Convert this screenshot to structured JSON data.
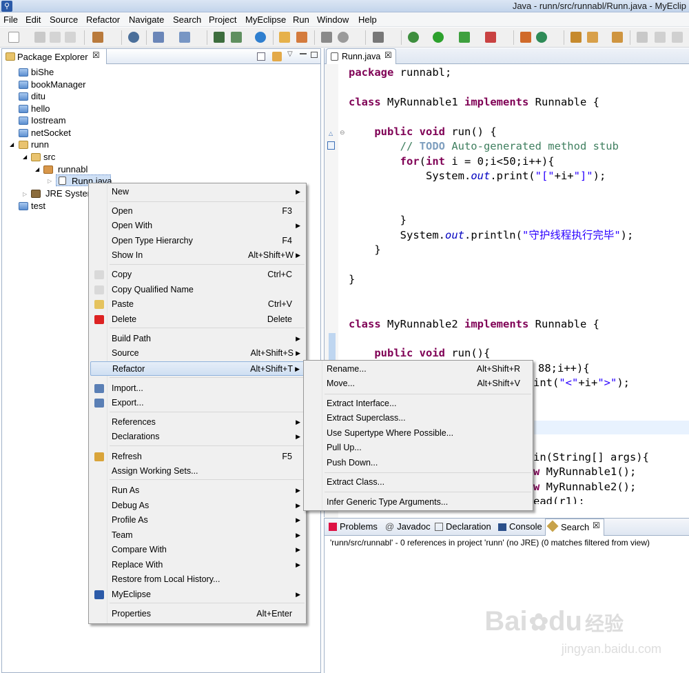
{
  "window": {
    "title": "Java - runn/src/runnabl/Runn.java - MyEclip"
  },
  "menubar": [
    "File",
    "Edit",
    "Source",
    "Refactor",
    "Navigate",
    "Search",
    "Project",
    "MyEclipse",
    "Run",
    "Window",
    "Help"
  ],
  "explorer": {
    "title": "Package Explorer",
    "close": "☒",
    "items": [
      "biShe",
      "bookManager",
      "ditu",
      "hello",
      "Iostream",
      "netSocket",
      "runn",
      "src",
      "runnabl",
      "Runn.java",
      "JRE System",
      "test"
    ]
  },
  "editor": {
    "tab": "Runn.java",
    "close": "☒",
    "code": {
      "l1": [
        "package",
        " runnabl;"
      ],
      "l2": [
        "class",
        " MyRunnable1 ",
        "implements",
        " Runnable {"
      ],
      "l3": [
        "    ",
        "public",
        " ",
        "void",
        " run() {"
      ],
      "l4": [
        "        // ",
        "TODO",
        " Auto-generated method stub"
      ],
      "l5": [
        "        ",
        "for",
        "(",
        "int",
        " i = 0;i<50;i++){"
      ],
      "l6": [
        "            System.",
        "out",
        ".print(",
        "\"[\"",
        "+i+",
        "\"]\"",
        ");"
      ],
      "l7": "        }",
      "l8": [
        "        System.",
        "out",
        ".println(",
        "\"守护线程执行完毕\"",
        ");"
      ],
      "l9": "    }",
      "l10": "}",
      "l11": [
        "class",
        " MyRunnable2 ",
        "implements",
        " Runnable {"
      ],
      "l12": [
        "    ",
        "public",
        " ",
        "void",
        " run(){"
      ],
      "l13": "88;i++){",
      "l14": [
        "int(",
        "\"<\"",
        "+i+",
        "\">\"",
        ");"
      ],
      "l15": "in(String[] args){",
      "l16": [
        "w",
        " MyRunnable1();"
      ],
      "l17": [
        "w",
        " MyRunnable2();"
      ],
      "l18": "ead(r1);"
    }
  },
  "bottom": {
    "tabs": [
      "Problems",
      "Javadoc",
      "Declaration",
      "Console",
      "Search"
    ],
    "close": "☒",
    "status": "'runn/src/runnabl' - 0 references in project 'runn' (no JRE) (0 matches filtered from view)"
  },
  "context_menu": {
    "items": [
      {
        "label": "New",
        "shortcut": ""
      },
      {
        "label": "Open",
        "shortcut": "F3"
      },
      {
        "label": "Open With",
        "shortcut": ""
      },
      {
        "label": "Open Type Hierarchy",
        "shortcut": "F4"
      },
      {
        "label": "Show In",
        "shortcut": "Alt+Shift+W"
      },
      {
        "label": "Copy",
        "shortcut": "Ctrl+C"
      },
      {
        "label": "Copy Qualified Name",
        "shortcut": ""
      },
      {
        "label": "Paste",
        "shortcut": "Ctrl+V"
      },
      {
        "label": "Delete",
        "shortcut": "Delete"
      },
      {
        "label": "Build Path",
        "shortcut": ""
      },
      {
        "label": "Source",
        "shortcut": "Alt+Shift+S"
      },
      {
        "label": "Refactor",
        "shortcut": "Alt+Shift+T"
      },
      {
        "label": "Import...",
        "shortcut": ""
      },
      {
        "label": "Export...",
        "shortcut": ""
      },
      {
        "label": "References",
        "shortcut": ""
      },
      {
        "label": "Declarations",
        "shortcut": ""
      },
      {
        "label": "Refresh",
        "shortcut": "F5"
      },
      {
        "label": "Assign Working Sets...",
        "shortcut": ""
      },
      {
        "label": "Run As",
        "shortcut": ""
      },
      {
        "label": "Debug As",
        "shortcut": ""
      },
      {
        "label": "Profile As",
        "shortcut": ""
      },
      {
        "label": "Team",
        "shortcut": ""
      },
      {
        "label": "Compare With",
        "shortcut": ""
      },
      {
        "label": "Replace With",
        "shortcut": ""
      },
      {
        "label": "Restore from Local History...",
        "shortcut": ""
      },
      {
        "label": "MyEclipse",
        "shortcut": ""
      },
      {
        "label": "Properties",
        "shortcut": "Alt+Enter"
      }
    ]
  },
  "refactor_menu": {
    "items": [
      {
        "label": "Rename...",
        "shortcut": "Alt+Shift+R"
      },
      {
        "label": "Move...",
        "shortcut": "Alt+Shift+V"
      },
      {
        "label": "Extract Interface...",
        "shortcut": ""
      },
      {
        "label": "Extract Superclass...",
        "shortcut": ""
      },
      {
        "label": "Use Supertype Where Possible...",
        "shortcut": ""
      },
      {
        "label": "Pull Up...",
        "shortcut": ""
      },
      {
        "label": "Push Down...",
        "shortcut": ""
      },
      {
        "label": "Extract Class...",
        "shortcut": ""
      },
      {
        "label": "Infer Generic Type Arguments...",
        "shortcut": ""
      }
    ]
  },
  "arrow": "▶",
  "watermark": {
    "logo": "Bai",
    "logo2": "du",
    "cn": "经验",
    "url": "jingyan.baidu.com"
  }
}
